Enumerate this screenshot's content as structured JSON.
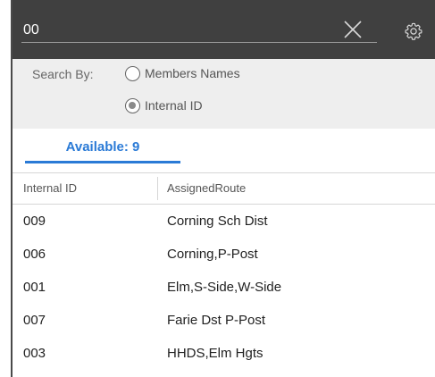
{
  "search": {
    "value": "00",
    "clear_icon": "close-icon",
    "settings_icon": "gear-icon"
  },
  "search_by": {
    "label": "Search By:",
    "options": [
      {
        "label": "Members Names",
        "checked": false
      },
      {
        "label": "Internal ID",
        "checked": true
      }
    ]
  },
  "tabs": {
    "available_label": "Available: 9"
  },
  "table": {
    "columns": [
      "Internal ID",
      "AssignedRoute"
    ],
    "rows": [
      {
        "id": "009",
        "route": "Corning Sch Dist"
      },
      {
        "id": "006",
        "route": "Corning,P-Post"
      },
      {
        "id": "001",
        "route": "Elm,S-Side,W-Side"
      },
      {
        "id": "007",
        "route": "Farie Dst P-Post"
      },
      {
        "id": "003",
        "route": "HHDS,Elm Hgts"
      }
    ]
  },
  "colors": {
    "search_bg": "#404040",
    "accent": "#2a7ad6",
    "filter_bg": "#eeeeee"
  }
}
